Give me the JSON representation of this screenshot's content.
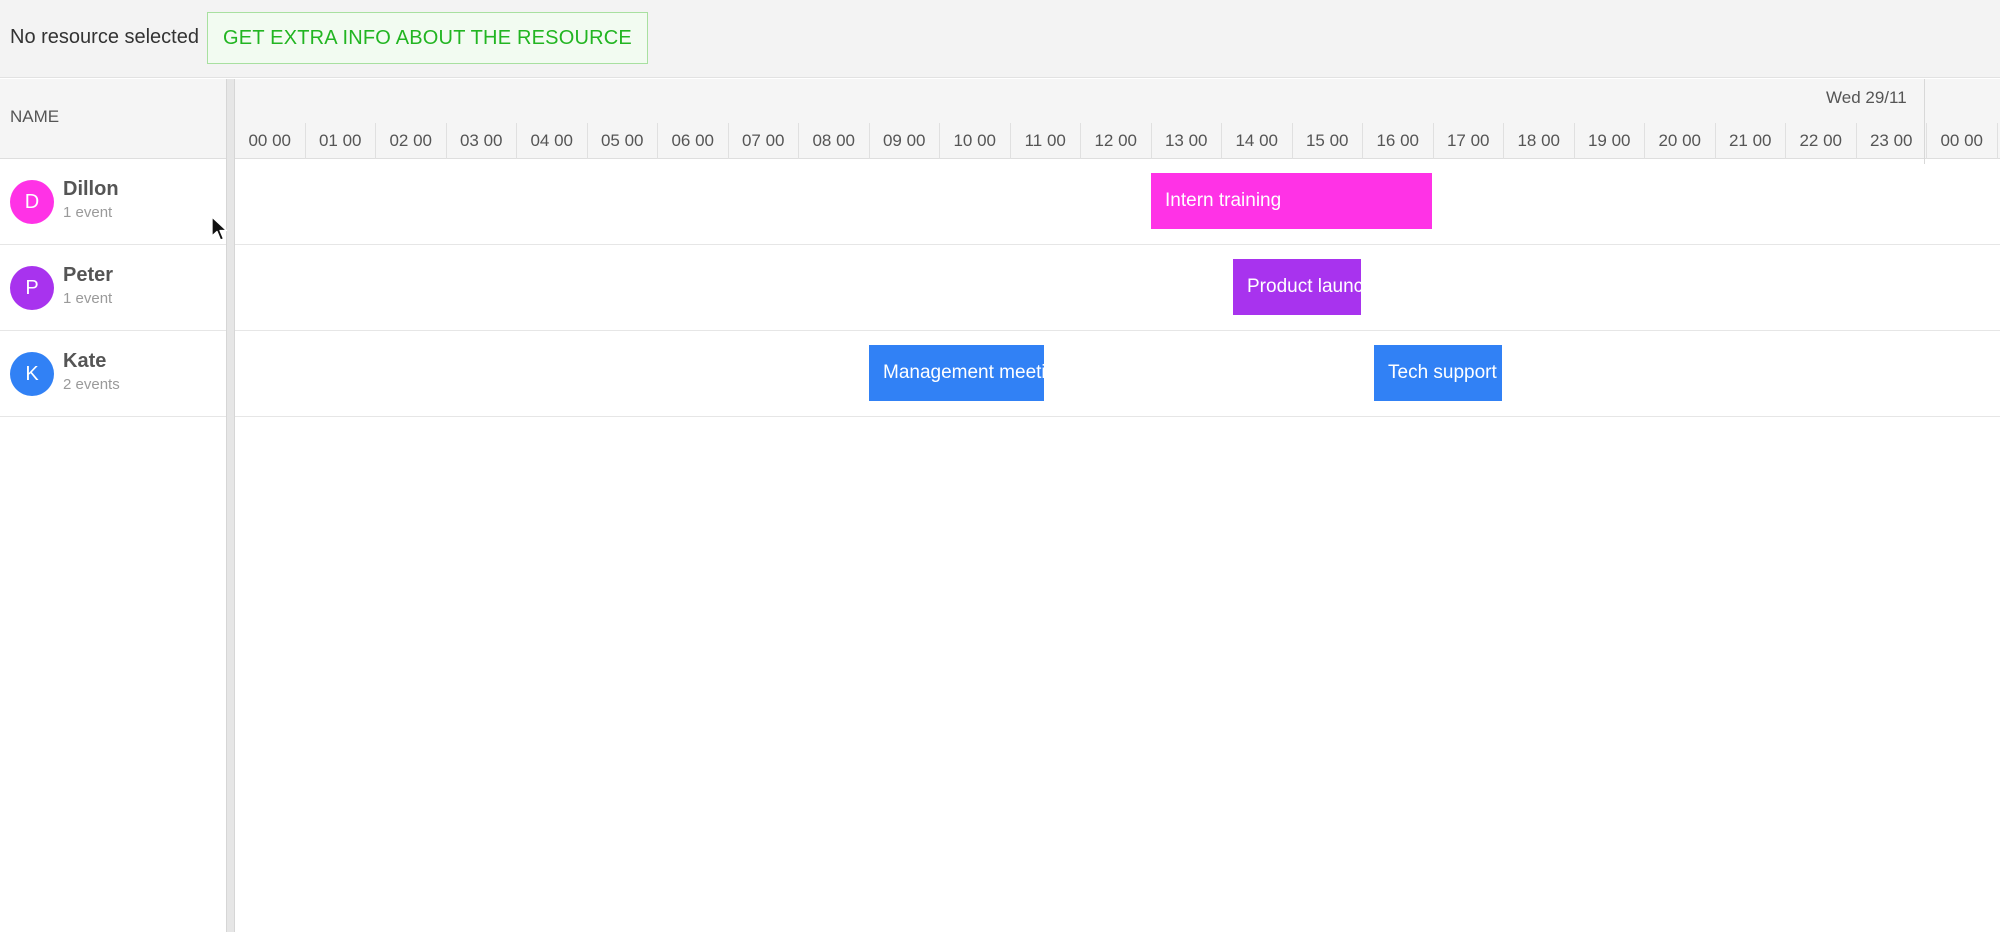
{
  "toolbar": {
    "status_text": "No resource selected",
    "extra_info_button": "GET EXTRA INFO ABOUT THE RESOURCE"
  },
  "resources_header": {
    "name_column": "NAME"
  },
  "resources": [
    {
      "initial": "D",
      "name": "Dillon",
      "count": "1 event",
      "color": "#ff32e6"
    },
    {
      "initial": "P",
      "name": "Peter",
      "count": "1 event",
      "color": "#a833ee"
    },
    {
      "initial": "K",
      "name": "Kate",
      "count": "2 events",
      "color": "#3181f5"
    }
  ],
  "timeline": {
    "day_label": "Wed 29/11",
    "hours": [
      "00 00",
      "01 00",
      "02 00",
      "03 00",
      "04 00",
      "05 00",
      "06 00",
      "07 00",
      "08 00",
      "09 00",
      "10 00",
      "11 00",
      "12 00",
      "13 00",
      "14 00",
      "15 00",
      "16 00",
      "17 00",
      "18 00",
      "19 00",
      "20 00",
      "21 00",
      "22 00",
      "23 00",
      "00 00"
    ]
  },
  "events": {
    "intern_training": {
      "title": "Intern training",
      "color": "#ff32e6"
    },
    "product_launch": {
      "title": "Product launch",
      "color": "#a833ee"
    },
    "management_meeting": {
      "title": "Management meeting",
      "color": "#3181f5"
    },
    "tech_support": {
      "title": "Tech support meeting",
      "color": "#3181f5"
    }
  },
  "icons": {
    "cursor": "mouse-pointer-icon"
  }
}
